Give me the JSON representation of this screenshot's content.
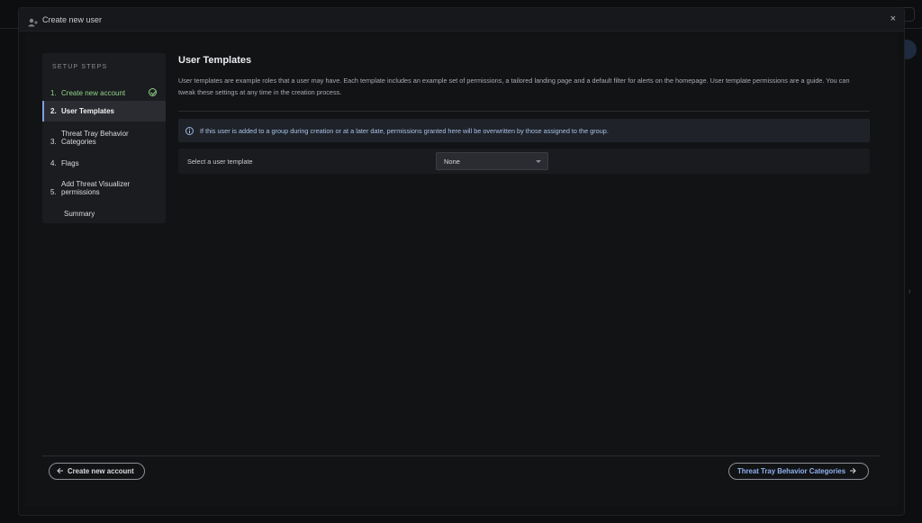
{
  "modal": {
    "title": "Create new user",
    "close_label": "×"
  },
  "steps": {
    "heading": "SETUP STEPS",
    "items": [
      {
        "num": "1.",
        "label": "Create new account",
        "state": "completed"
      },
      {
        "num": "2.",
        "label": "User Templates",
        "state": "active"
      },
      {
        "num": "3.",
        "label": "Threat Tray Behavior Categories",
        "label_lines": [
          "Threat Tray Behavior",
          "Categories"
        ],
        "state": "pending"
      },
      {
        "num": "4.",
        "label": "Flags",
        "state": "pending"
      },
      {
        "num": "5.",
        "label": "Add Threat Visualizer permissions",
        "label_lines": [
          "Add Threat Visualizer",
          "permissions"
        ],
        "state": "pending"
      },
      {
        "num": "",
        "label": "Summary",
        "state": "pending"
      }
    ]
  },
  "main": {
    "title": "User Templates",
    "description": "User templates are example roles that a user may have. Each template includes an example set of permissions, a tailored landing page and a default filter for alerts on the homepage. User template permissions are a guide. You can tweak these settings at any time in the creation process.",
    "info": "If this user is added to a group during creation or at a later date, permissions granted here will be overwritten by those assigned to the group.",
    "template_label": "Select a user template",
    "template_value": "None"
  },
  "footer": {
    "back_label": "Create new account",
    "next_label": "Threat Tray Behavior Categories"
  },
  "colors": {
    "accent": "#7d9fe0",
    "success": "#8fd38a",
    "info_text": "#a9c0e6"
  },
  "icons": {
    "header": "user-add-icon",
    "close": "close-icon",
    "completed": "check-circle-icon",
    "info": "info-icon",
    "back": "arrow-left-icon",
    "next": "arrow-right-icon",
    "caret": "caret-down-icon"
  }
}
